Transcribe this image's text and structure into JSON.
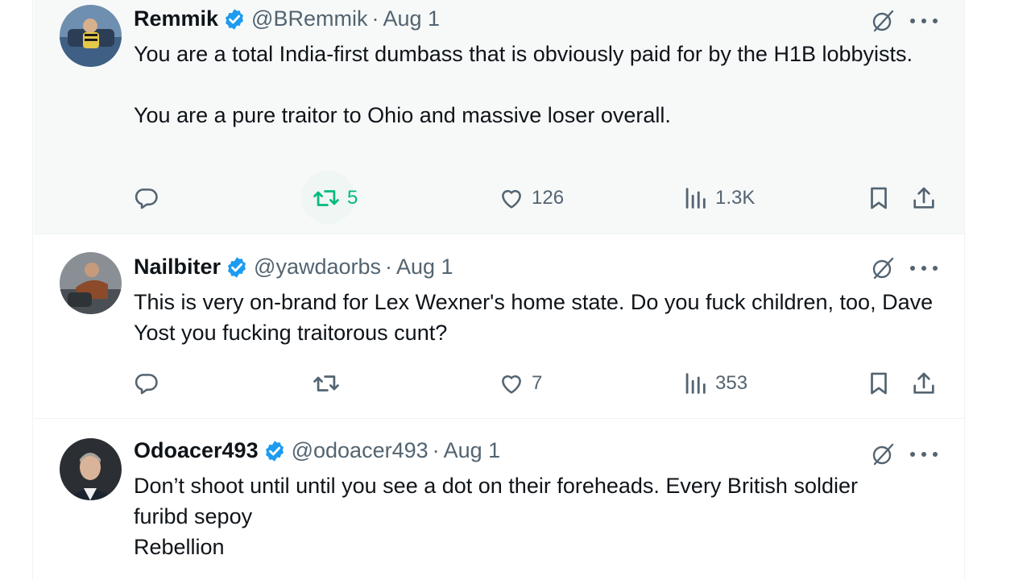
{
  "tweets": [
    {
      "name": "Remmik",
      "handle": "@BRemmik",
      "separator": "·",
      "date": "Aug 1",
      "text_paragraphs": [
        "You are a total India-first dumbass that is obviously paid for by the H1B lobbyists.",
        "You are a pure traitor to Ohio and massive loser overall."
      ],
      "replies": "",
      "retweets": "5",
      "likes": "126",
      "views": "1.3K",
      "retweet_active": true
    },
    {
      "name": "Nailbiter",
      "handle": "@yawdaorbs",
      "separator": "·",
      "date": "Aug 1",
      "text_paragraphs": [
        "This is very on-brand for Lex Wexner's home state. Do you fuck children, too, Dave Yost you fucking traitorous cunt?"
      ],
      "replies": "",
      "retweets": "",
      "likes": "7",
      "views": "353",
      "retweet_active": false
    },
    {
      "name": "Odoacer493",
      "handle": "@odoacer493",
      "separator": "·",
      "date": "Aug 1",
      "text_lines": [
        "Don’t shoot until until you see a dot on their foreheads. Every British soldier",
        "furibd sepoy",
        "Rebellion"
      ]
    }
  ],
  "icons": {
    "verified": "verified-badge-icon",
    "grok": "grok-icon",
    "more": "more-icon",
    "reply": "reply-icon",
    "retweet": "retweet-icon",
    "like": "heart-icon",
    "views": "views-chart-icon",
    "bookmark": "bookmark-icon",
    "share": "share-icon"
  },
  "colors": {
    "text_primary": "#0f1419",
    "text_secondary": "#536471",
    "verified_blue": "#1d9bf0",
    "retweet_green": "#00ba7c",
    "hover_background": "#f7f9f9"
  }
}
